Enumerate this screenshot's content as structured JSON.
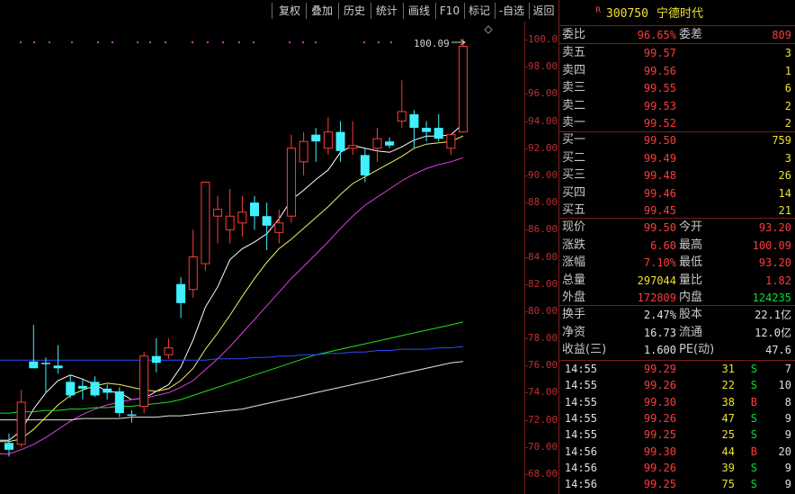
{
  "toolbar": {
    "buttons": [
      "复权",
      "叠加",
      "历史",
      "统计",
      "画线",
      "F10",
      "标记",
      "-自选",
      "返回"
    ]
  },
  "stock": {
    "badge": "R",
    "code": "300750",
    "name": "宁德时代"
  },
  "chart_data": {
    "type": "candlestick",
    "y_ticks": [
      "100.0",
      "98.00",
      "96.00",
      "94.00",
      "92.00",
      "90.00",
      "88.00",
      "86.00",
      "84.00",
      "82.00",
      "80.00",
      "78.00",
      "76.00",
      "74.00",
      "72.00",
      "70.00",
      "68.00"
    ],
    "ylim": [
      67.5,
      102.0
    ],
    "max_annotation": "100.09",
    "candles": [
      {
        "o": 70.3,
        "h": 71.0,
        "l": 69.3,
        "c": 69.8
      },
      {
        "o": 70.2,
        "h": 74.2,
        "l": 70.0,
        "c": 73.3
      },
      {
        "o": 76.3,
        "h": 79.0,
        "l": 75.8,
        "c": 75.8
      },
      {
        "o": 76.2,
        "h": 76.6,
        "l": 74.0,
        "c": 76.1
      },
      {
        "o": 76.0,
        "h": 77.5,
        "l": 75.4,
        "c": 75.8
      },
      {
        "o": 74.8,
        "h": 75.3,
        "l": 73.6,
        "c": 73.8
      },
      {
        "o": 74.5,
        "h": 75.0,
        "l": 73.5,
        "c": 74.3
      },
      {
        "o": 74.8,
        "h": 75.2,
        "l": 73.7,
        "c": 73.8
      },
      {
        "o": 74.3,
        "h": 74.6,
        "l": 73.5,
        "c": 74.0
      },
      {
        "o": 74.1,
        "h": 74.4,
        "l": 72.2,
        "c": 72.5
      },
      {
        "o": 72.4,
        "h": 72.7,
        "l": 71.8,
        "c": 72.3
      },
      {
        "o": 73.0,
        "h": 77.0,
        "l": 72.5,
        "c": 76.7
      },
      {
        "o": 76.7,
        "h": 78.0,
        "l": 75.5,
        "c": 76.2
      },
      {
        "o": 76.8,
        "h": 78.0,
        "l": 76.5,
        "c": 77.3
      },
      {
        "o": 82.0,
        "h": 82.5,
        "l": 79.5,
        "c": 80.6
      },
      {
        "o": 81.6,
        "h": 86.0,
        "l": 81.0,
        "c": 84.0
      },
      {
        "o": 83.5,
        "h": 89.5,
        "l": 83.0,
        "c": 89.5
      },
      {
        "o": 87.0,
        "h": 88.5,
        "l": 85.0,
        "c": 87.5
      },
      {
        "o": 86.0,
        "h": 89.0,
        "l": 85.0,
        "c": 87.0
      },
      {
        "o": 86.5,
        "h": 88.5,
        "l": 85.5,
        "c": 87.3
      },
      {
        "o": 88.0,
        "h": 88.5,
        "l": 86.0,
        "c": 87.0
      },
      {
        "o": 87.0,
        "h": 88.0,
        "l": 84.5,
        "c": 86.3
      },
      {
        "o": 85.8,
        "h": 87.5,
        "l": 85.0,
        "c": 86.5
      },
      {
        "o": 87.0,
        "h": 93.0,
        "l": 86.5,
        "c": 92.0
      },
      {
        "o": 91.0,
        "h": 93.2,
        "l": 90.0,
        "c": 92.5
      },
      {
        "o": 93.0,
        "h": 93.5,
        "l": 91.0,
        "c": 92.5
      },
      {
        "o": 92.0,
        "h": 94.3,
        "l": 91.5,
        "c": 93.2
      },
      {
        "o": 93.2,
        "h": 94.0,
        "l": 91.0,
        "c": 91.8
      },
      {
        "o": 92.0,
        "h": 94.0,
        "l": 91.5,
        "c": 92.2
      },
      {
        "o": 91.5,
        "h": 92.0,
        "l": 89.5,
        "c": 90.0
      },
      {
        "o": 92.0,
        "h": 93.5,
        "l": 91.0,
        "c": 92.7
      },
      {
        "o": 92.5,
        "h": 92.8,
        "l": 92.0,
        "c": 92.2
      },
      {
        "o": 94.0,
        "h": 97.0,
        "l": 93.5,
        "c": 94.7
      },
      {
        "o": 94.5,
        "h": 94.8,
        "l": 92.0,
        "c": 93.5
      },
      {
        "o": 93.5,
        "h": 94.0,
        "l": 92.5,
        "c": 93.2
      },
      {
        "o": 93.5,
        "h": 94.5,
        "l": 92.5,
        "c": 92.7
      },
      {
        "o": 92.0,
        "h": 93.0,
        "l": 91.5,
        "c": 93.0
      },
      {
        "o": 93.2,
        "h": 100.09,
        "l": 93.2,
        "c": 99.5
      }
    ],
    "ma_series": [
      {
        "color": "#ffffff",
        "values": [
          70.5,
          71.2,
          72.8,
          74.0,
          74.9,
          75.3,
          75.0,
          74.6,
          74.1,
          74.0,
          73.5,
          73.6,
          74.1,
          74.6,
          75.9,
          77.9,
          80.3,
          81.8,
          83.8,
          84.6,
          85.1,
          85.7,
          86.8,
          88.2,
          88.9,
          89.7,
          90.4,
          91.7,
          92.2,
          92.0,
          91.8,
          91.7,
          92.1,
          92.6,
          92.9,
          92.9,
          93.0,
          93.8
        ]
      },
      {
        "color": "#f0f060",
        "values": [
          70.4,
          70.6,
          71.3,
          72.2,
          73.1,
          73.8,
          74.2,
          74.5,
          74.7,
          74.6,
          74.4,
          74.2,
          74.1,
          74.3,
          74.9,
          75.8,
          77.2,
          78.4,
          79.7,
          81.1,
          82.4,
          83.6,
          84.6,
          85.3,
          86.1,
          86.9,
          87.7,
          88.6,
          89.4,
          89.9,
          90.4,
          90.9,
          91.4,
          92.0,
          92.3,
          92.4,
          92.5,
          92.9
        ]
      },
      {
        "color": "#e040e0",
        "values": [
          69.5,
          69.8,
          70.2,
          70.7,
          71.3,
          71.9,
          72.4,
          72.8,
          73.1,
          73.3,
          73.5,
          73.6,
          73.8,
          74.0,
          74.4,
          74.9,
          75.7,
          76.5,
          77.4,
          78.4,
          79.4,
          80.4,
          81.4,
          82.4,
          83.3,
          84.2,
          85.1,
          86.1,
          87.0,
          87.8,
          88.4,
          89.0,
          89.6,
          90.1,
          90.5,
          90.8,
          91.0,
          91.3
        ]
      },
      {
        "color": "#20e020",
        "values": [
          72.5,
          72.6,
          72.6,
          72.7,
          72.7,
          72.8,
          72.8,
          72.9,
          72.9,
          73.0,
          73.0,
          73.1,
          73.2,
          73.3,
          73.5,
          73.8,
          74.1,
          74.4,
          74.7,
          75.0,
          75.3,
          75.6,
          75.9,
          76.2,
          76.5,
          76.8,
          77.0,
          77.2,
          77.4,
          77.6,
          77.8,
          78.0,
          78.2,
          78.4,
          78.6,
          78.8,
          79.0,
          79.2
        ]
      },
      {
        "color": "#2a4cff",
        "values": [
          76.4,
          76.4,
          76.4,
          76.4,
          76.4,
          76.4,
          76.4,
          76.4,
          76.4,
          76.4,
          76.4,
          76.4,
          76.4,
          76.4,
          76.4,
          76.4,
          76.4,
          76.5,
          76.5,
          76.5,
          76.6,
          76.6,
          76.7,
          76.7,
          76.8,
          76.8,
          76.9,
          76.9,
          77.0,
          77.0,
          77.1,
          77.1,
          77.2,
          77.2,
          77.2,
          77.3,
          77.3,
          77.4
        ]
      },
      {
        "color": "#e8e8d0",
        "values": [
          72.0,
          72.0,
          72.0,
          72.0,
          72.0,
          72.0,
          72.1,
          72.1,
          72.1,
          72.1,
          72.2,
          72.2,
          72.2,
          72.3,
          72.3,
          72.4,
          72.5,
          72.6,
          72.7,
          72.8,
          73.0,
          73.2,
          73.4,
          73.6,
          73.8,
          74.0,
          74.2,
          74.4,
          74.6,
          74.8,
          75.0,
          75.2,
          75.4,
          75.6,
          75.8,
          76.0,
          76.2,
          76.3
        ]
      }
    ]
  },
  "quote": {
    "webi": {
      "label": "委比",
      "value": "96.65%",
      "label2": "委差",
      "value2": "809"
    },
    "asks": [
      {
        "label": "卖五",
        "price": "99.57",
        "vol": "3"
      },
      {
        "label": "卖四",
        "price": "99.56",
        "vol": "1"
      },
      {
        "label": "卖三",
        "price": "99.55",
        "vol": "6"
      },
      {
        "label": "卖二",
        "price": "99.53",
        "vol": "2"
      },
      {
        "label": "卖一",
        "price": "99.52",
        "vol": "2"
      }
    ],
    "bids": [
      {
        "label": "买一",
        "price": "99.50",
        "vol": "759"
      },
      {
        "label": "买二",
        "price": "99.49",
        "vol": "3"
      },
      {
        "label": "买三",
        "price": "99.48",
        "vol": "26"
      },
      {
        "label": "买四",
        "price": "99.46",
        "vol": "14"
      },
      {
        "label": "买五",
        "price": "99.45",
        "vol": "21"
      }
    ],
    "stats": [
      {
        "l1": "现价",
        "v1": "99.50",
        "l2": "今开",
        "v2": "93.20"
      },
      {
        "l1": "涨跌",
        "v1": "6.60",
        "l2": "最高",
        "v2": "100.09"
      },
      {
        "l1": "涨幅",
        "v1": "7.10%",
        "l2": "最低",
        "v2": "93.20"
      },
      {
        "l1": "总量",
        "v1": "297044",
        "l2": "量比",
        "v2": "1.82"
      },
      {
        "l1": "外盘",
        "v1": "172809",
        "l2": "内盘",
        "v2": "124235"
      }
    ],
    "fundamentals": [
      {
        "l1": "换手",
        "v1": "2.47%",
        "l2": "股本",
        "v2": "22.1亿"
      },
      {
        "l1": "净资",
        "v1": "16.73",
        "l2": "流通",
        "v2": "12.0亿"
      },
      {
        "l1": "收益(三)",
        "v1": "1.600",
        "l2": "PE(动)",
        "v2": "47.6"
      }
    ],
    "ticks": [
      {
        "time": "14:55",
        "price": "99.29",
        "vol": "31",
        "side": "S",
        "n": "7"
      },
      {
        "time": "14:55",
        "price": "99.26",
        "vol": "22",
        "side": "S",
        "n": "10"
      },
      {
        "time": "14:55",
        "price": "99.30",
        "vol": "38",
        "side": "B",
        "n": "8"
      },
      {
        "time": "14:55",
        "price": "99.26",
        "vol": "47",
        "side": "S",
        "n": "9"
      },
      {
        "time": "14:55",
        "price": "99.25",
        "vol": "25",
        "side": "S",
        "n": "9"
      },
      {
        "time": "14:56",
        "price": "99.30",
        "vol": "44",
        "side": "B",
        "n": "20"
      },
      {
        "time": "14:56",
        "price": "99.26",
        "vol": "39",
        "side": "S",
        "n": "9"
      },
      {
        "time": "14:56",
        "price": "99.25",
        "vol": "75",
        "side": "S",
        "n": "9"
      }
    ]
  }
}
